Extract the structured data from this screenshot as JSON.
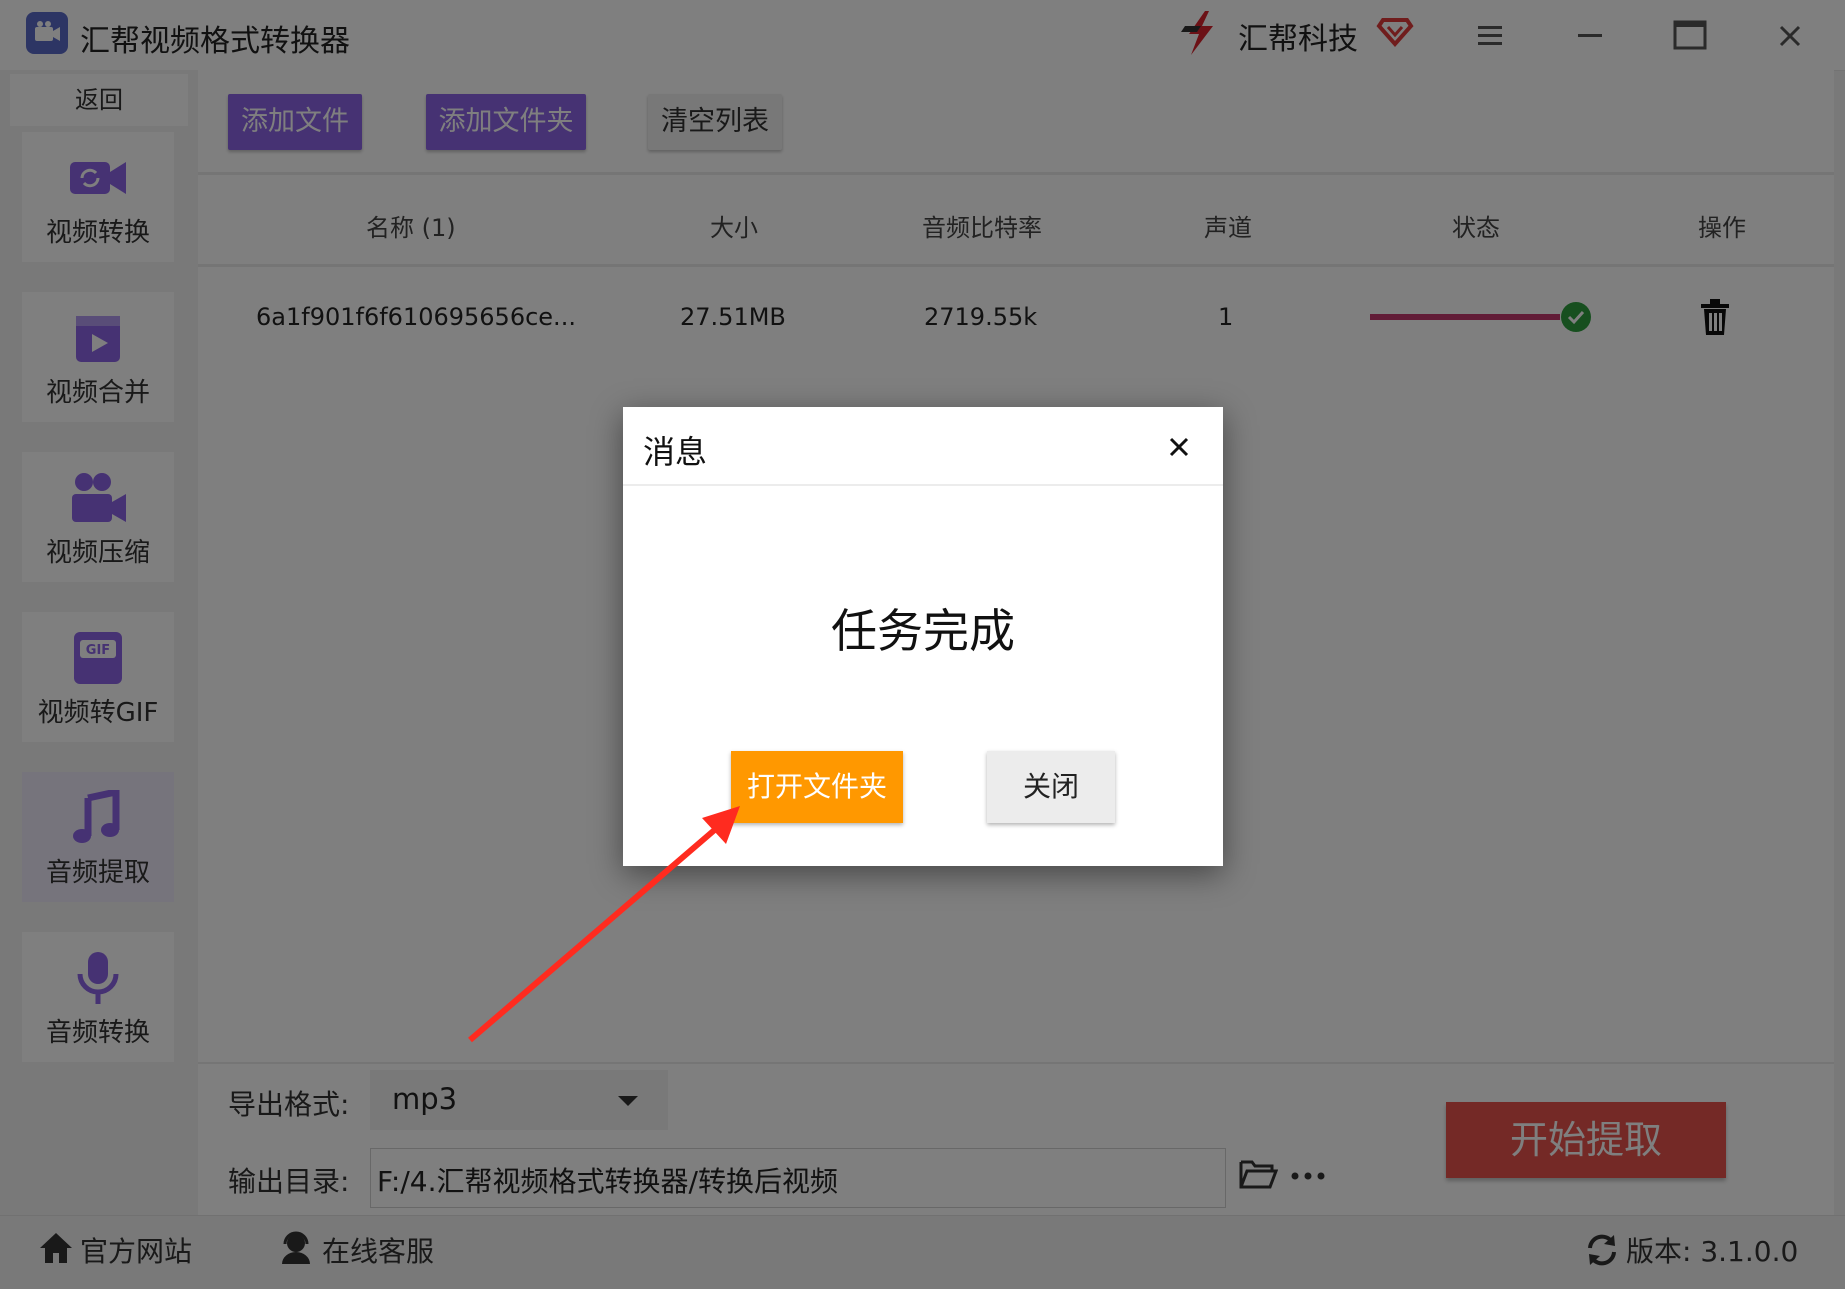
{
  "window": {
    "title": "汇帮视频格式转换器",
    "brand": "汇帮科技"
  },
  "sidebar": {
    "back_label": "返回",
    "items": [
      {
        "label": "视频转换",
        "icon": "video-convert-icon"
      },
      {
        "label": "视频合并",
        "icon": "video-merge-icon"
      },
      {
        "label": "视频压缩",
        "icon": "video-compress-icon"
      },
      {
        "label": "视频转GIF",
        "icon": "gif-icon"
      },
      {
        "label": "音频提取",
        "icon": "music-note-icon",
        "active": true
      },
      {
        "label": "音频转换",
        "icon": "microphone-icon"
      }
    ]
  },
  "toolbar": {
    "add_file": "添加文件",
    "add_folder": "添加文件夹",
    "clear_list": "清空列表"
  },
  "table": {
    "headers": [
      "名称 (1)",
      "大小",
      "音频比特率",
      "声道",
      "状态",
      "操作"
    ],
    "rows": [
      {
        "name": "6a1f901f6f610695656ce...",
        "size": "27.51MB",
        "bitrate": "2719.55k",
        "channels": "1",
        "progress": 100,
        "status": "完成"
      }
    ]
  },
  "output": {
    "format_label": "导出格式:",
    "format_value": "mp3",
    "dir_label": "输出目录:",
    "dir_value": "F:/4.汇帮视频格式转换器/转换后视频",
    "start_button": "开始提取"
  },
  "statusbar": {
    "website": "官方网站",
    "support": "在线客服",
    "version": "版本:  3.1.0.0"
  },
  "dialog": {
    "title": "消息",
    "message": "任务完成",
    "open_folder": "打开文件夹",
    "close": "关闭"
  },
  "colors": {
    "accent_purple": "#8c64e6",
    "start_red": "#e8534d",
    "dialog_orange": "#ff9800",
    "progress": "#c4386e",
    "success_green": "#2e9e3e",
    "annotation_arrow": "#ff2b1f"
  }
}
